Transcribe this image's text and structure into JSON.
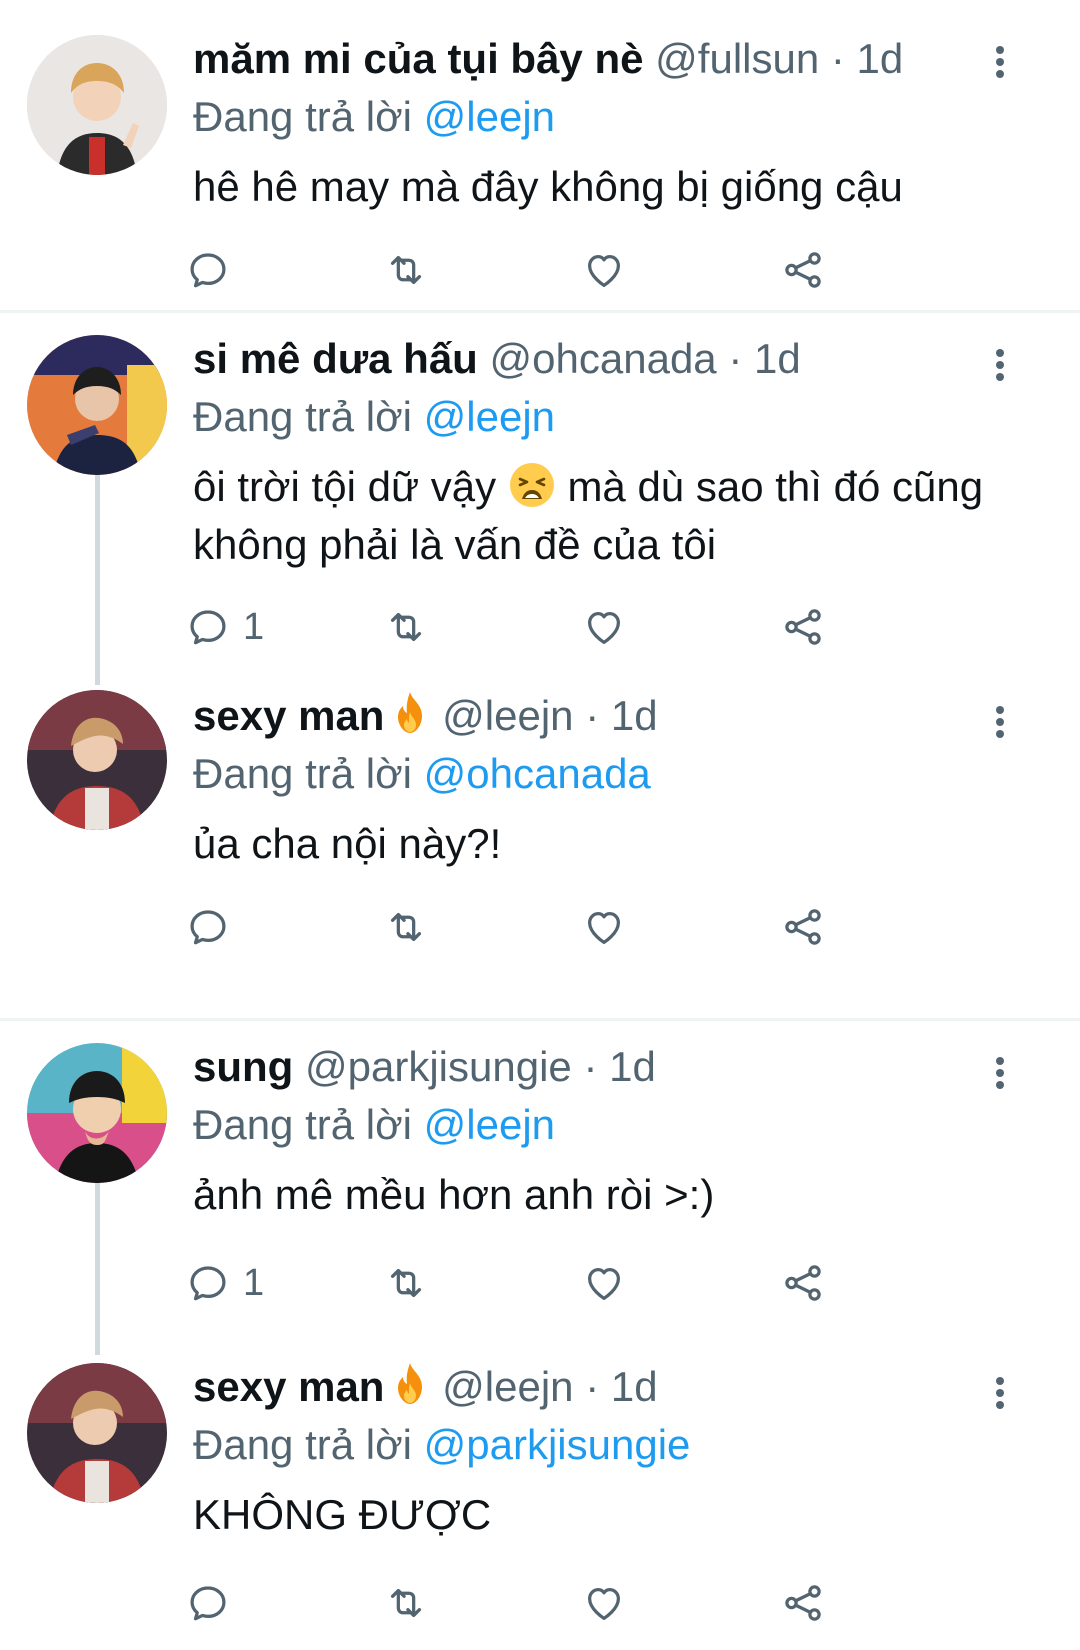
{
  "tweets": [
    {
      "name": "măm mi của tụi bây nè",
      "handle": "@fullsun",
      "sep": "·",
      "time": "1d",
      "reply_prefix": "Đang trả lời",
      "reply_to": "@leejn",
      "text": "hê hê may mà đây không bị giống cậu",
      "reply_count": ""
    },
    {
      "name": "si mê dưa hấu",
      "handle": "@ohcanada",
      "sep": "·",
      "time": "1d",
      "reply_prefix": "Đang trả lời",
      "reply_to": "@leejn",
      "text_before_emoji": "ôi trời tội dữ vậy",
      "emoji": "weary-face-emoji",
      "text_after_emoji": "mà dù sao thì đó cũng không phải là vấn đề của tôi",
      "reply_count": "1"
    },
    {
      "name": "sexy man",
      "name_emoji": "fire-emoji",
      "handle": "@leejn",
      "sep": "·",
      "time": "1d",
      "reply_prefix": "Đang trả lời",
      "reply_to": "@ohcanada",
      "text": "ủa cha nội này?!",
      "reply_count": ""
    },
    {
      "name": "sung",
      "handle": "@parkjisungie",
      "sep": "·",
      "time": "1d",
      "reply_prefix": "Đang trả lời",
      "reply_to": "@leejn",
      "text": "ảnh mê mều hơn anh ròi >:)",
      "reply_count": "1"
    },
    {
      "name": "sexy man",
      "name_emoji": "fire-emoji",
      "handle": "@leejn",
      "sep": "·",
      "time": "1d",
      "reply_prefix": "Đang trả lời",
      "reply_to": "@parkjisungie",
      "text": "KHÔNG ĐƯỢC",
      "reply_count": ""
    }
  ],
  "colors": {
    "text": "#0f1419",
    "secondary": "#536471",
    "link": "#1d9bf0",
    "divider": "#eff3f4",
    "thread_line": "#cfd9de"
  }
}
